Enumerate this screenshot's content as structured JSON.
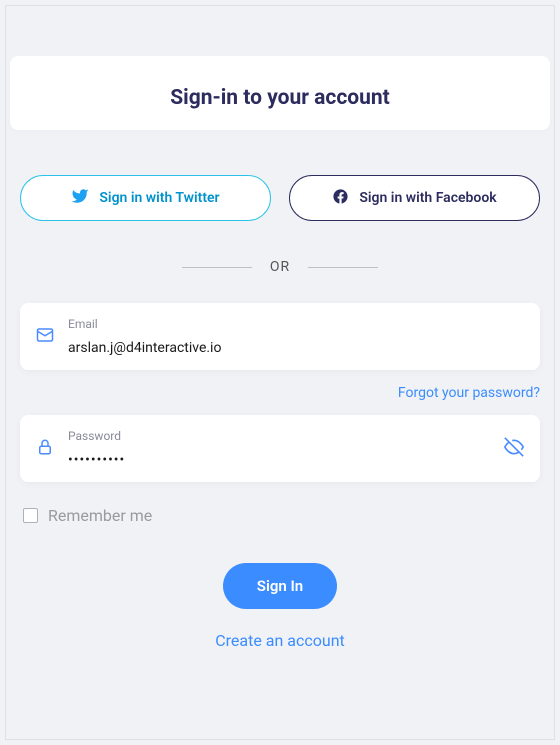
{
  "title": "Sign-in to your account",
  "social": {
    "twitter_label": "Sign in with Twitter",
    "facebook_label": "Sign in with Facebook"
  },
  "divider": "OR",
  "fields": {
    "email_label": "Email",
    "email_value": "arslan.j@d4interactive.io",
    "password_label": "Password",
    "password_value": "••••••••••"
  },
  "forgot_label": "Forgot your password?",
  "remember_label": "Remember me",
  "signin_label": "Sign In",
  "create_label": "Create an account"
}
